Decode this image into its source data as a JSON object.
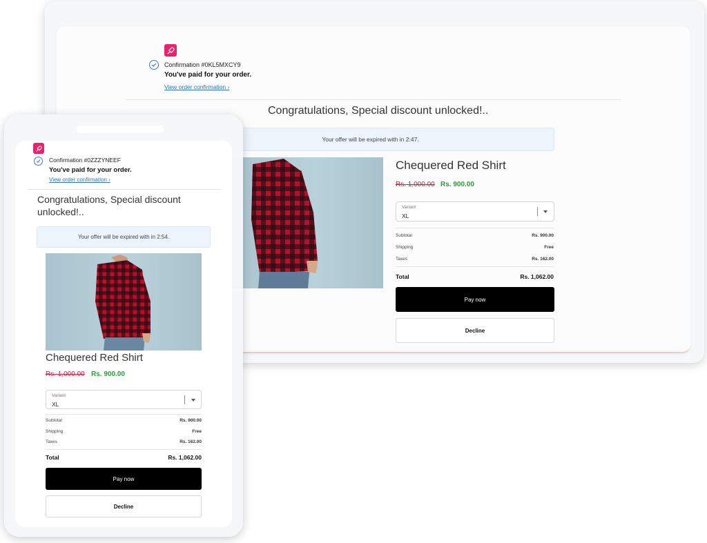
{
  "brand": {
    "accent": "#e8226f",
    "logo_icon": "rocket-icon"
  },
  "desktop": {
    "confirmation_number": "Confirmation #0KL5MXCY9",
    "paid_text": "You've paid for your order.",
    "view_link": "View order confirmation ›",
    "congrats": "Congratulations, Special discount unlocked!..",
    "timer_text": "Your offer will be expired with in 2:47.",
    "product_title": "Chequered Red Shirt",
    "price_old": "Rs. 1,000.00",
    "price_new": "Rs. 900.00",
    "variant_label": "Variant",
    "variant_value": "XL",
    "summary": [
      {
        "label": "Subtotal",
        "value": "Rs. 900.00"
      },
      {
        "label": "Shipping",
        "value": "Free"
      },
      {
        "label": "Taxes",
        "value": "Rs. 162.00"
      }
    ],
    "total_label": "Total",
    "total_value": "Rs. 1,062.00",
    "pay_label": "Pay now",
    "decline_label": "Decline"
  },
  "mobile": {
    "confirmation_number": "Confirmation #0ZZZYNEEF",
    "paid_text": "You've paid for your order.",
    "view_link": "View order confirmation ›",
    "congrats_line1": "Congratulations, Special discount",
    "congrats_line2": "unlocked!..",
    "timer_text": "Your offer will be expired with in 2:54.",
    "product_title": "Chequered Red Shirt",
    "price_old": "Rs. 1,000.00",
    "price_new": "Rs. 900.00",
    "variant_label": "Variant",
    "variant_value": "XL",
    "summary": [
      {
        "label": "Subtotal",
        "value": "Rs. 900.00"
      },
      {
        "label": "Shipping",
        "value": "Free"
      },
      {
        "label": "Taxes",
        "value": "Rs. 162.00"
      }
    ],
    "total_label": "Total",
    "total_value": "Rs. 1,062.00",
    "pay_label": "Pay now",
    "decline_label": "Decline"
  },
  "colors": {
    "price_old": "#c4213c",
    "price_new": "#2e9b3a",
    "link": "#2a73c6",
    "check": "#3a78c9",
    "pay_button": "#000000",
    "shirt_red": "#b8102b"
  }
}
